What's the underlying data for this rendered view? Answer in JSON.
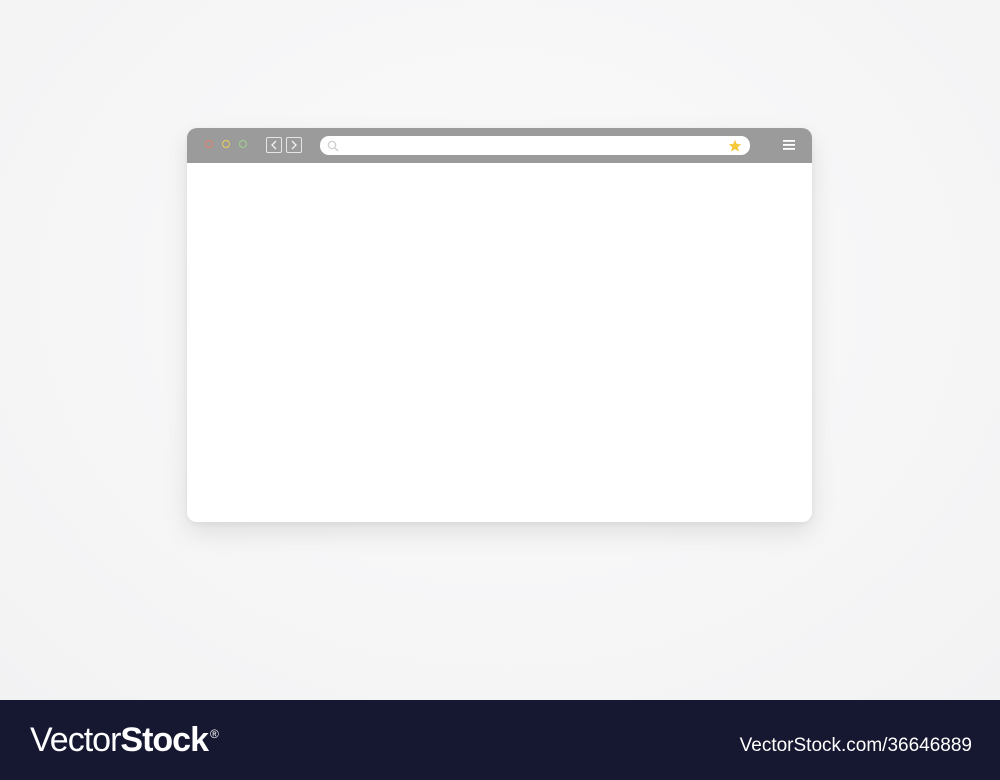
{
  "browser": {
    "traffic_lights": [
      {
        "name": "close",
        "color": "#e8826c"
      },
      {
        "name": "minimize",
        "color": "#e9cf5a"
      },
      {
        "name": "maximize",
        "color": "#9ed08a"
      }
    ],
    "nav": {
      "back_icon": "chevron-left-icon",
      "forward_icon": "chevron-right-icon"
    },
    "address_bar": {
      "value": "",
      "placeholder": "",
      "search_icon": "search-icon",
      "bookmark_icon": "star-icon",
      "bookmark_color": "#f5c93a"
    },
    "menu_icon": "hamburger-menu-icon",
    "toolbar_color": "#9b9b9c"
  },
  "footer": {
    "brand_regular": "Vector",
    "brand_bold": "Stock",
    "brand_mark": "®",
    "image_id": "VectorStock.com/36646889",
    "background": "#161730"
  }
}
